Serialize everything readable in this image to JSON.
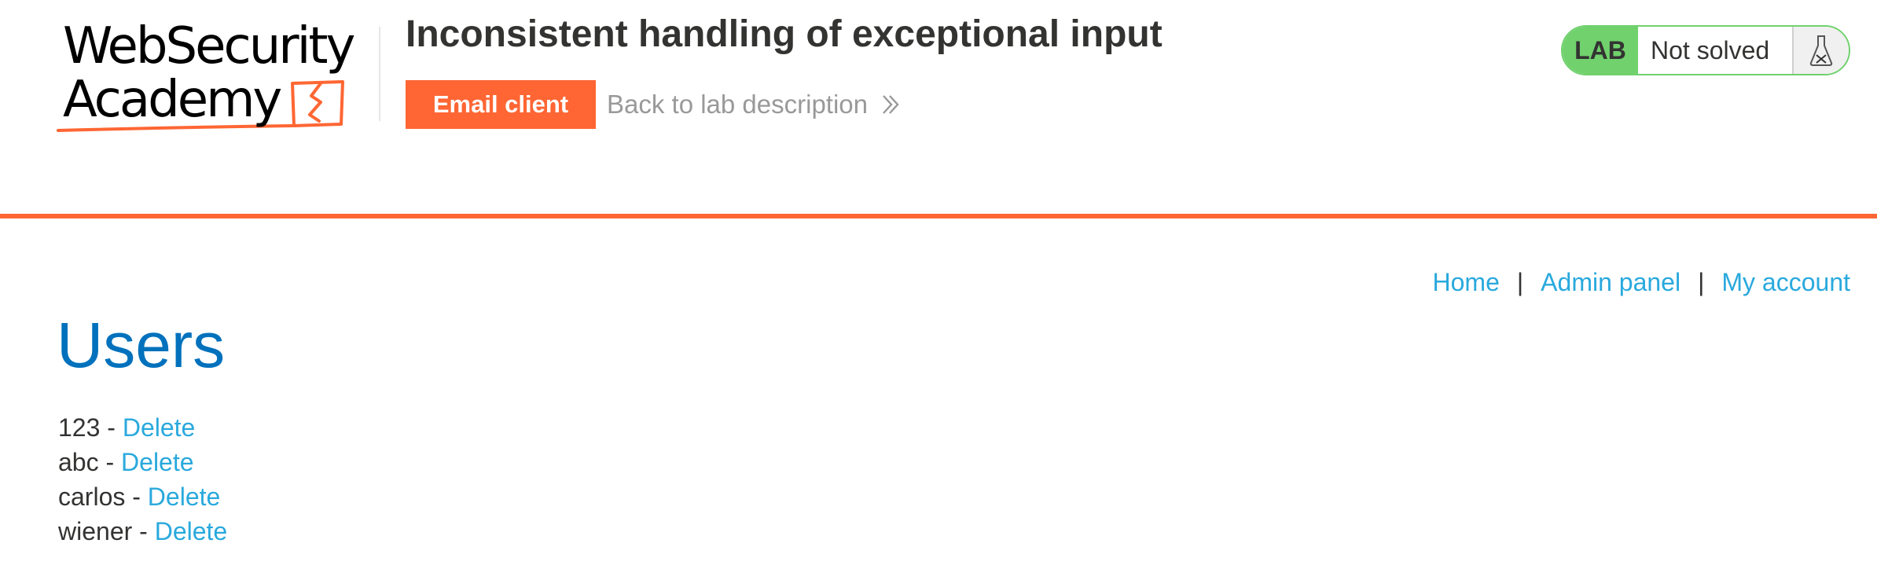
{
  "header": {
    "logo": {
      "line1": "WebSecurity",
      "line2": "Academy"
    },
    "lab_title": "Inconsistent handling of exceptional input",
    "email_client_label": "Email client",
    "back_link_label": "Back to lab description",
    "lab_status": {
      "badge": "LAB",
      "state": "Not solved"
    }
  },
  "nav": {
    "items": [
      {
        "label": "Home"
      },
      {
        "label": "Admin panel"
      },
      {
        "label": "My account"
      }
    ],
    "separator": "|"
  },
  "main": {
    "title": "Users",
    "users": [
      {
        "name": "123",
        "dash": " - ",
        "action": "Delete"
      },
      {
        "name": "abc",
        "dash": " - ",
        "action": "Delete"
      },
      {
        "name": "carlos",
        "dash": " - ",
        "action": "Delete"
      },
      {
        "name": "wiener",
        "dash": " - ",
        "action": "Delete"
      }
    ]
  },
  "colors": {
    "accent_orange": "#ff6633",
    "link_blue": "#29a9dd",
    "title_blue": "#0071bc",
    "lab_green": "#70d16d"
  },
  "icons": {
    "back_link": "double-chevron-right-icon",
    "lab_status": "flask-icon"
  }
}
